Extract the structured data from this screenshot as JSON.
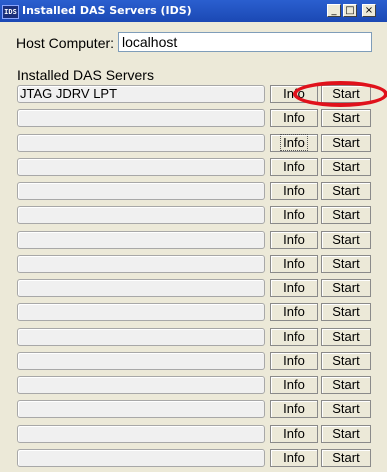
{
  "window": {
    "icon_text": "IDS",
    "title": "Installed DAS Servers (IDS)",
    "controls": {
      "minimize": "_",
      "maximize": "□",
      "close": "×"
    }
  },
  "host": {
    "label": "Host Computer:",
    "value": "localhost"
  },
  "servers": {
    "label": "Installed DAS Servers",
    "rows": [
      {
        "name": "JTAG JDRV LPT",
        "info": "Info",
        "start": "Start"
      },
      {
        "name": "",
        "info": "Info",
        "start": "Start"
      },
      {
        "name": "",
        "info": "Info",
        "start": "Start"
      },
      {
        "name": "",
        "info": "Info",
        "start": "Start"
      },
      {
        "name": "",
        "info": "Info",
        "start": "Start"
      },
      {
        "name": "",
        "info": "Info",
        "start": "Start"
      },
      {
        "name": "",
        "info": "Info",
        "start": "Start"
      },
      {
        "name": "",
        "info": "Info",
        "start": "Start"
      },
      {
        "name": "",
        "info": "Info",
        "start": "Start"
      },
      {
        "name": "",
        "info": "Info",
        "start": "Start"
      },
      {
        "name": "",
        "info": "Info",
        "start": "Start"
      },
      {
        "name": "",
        "info": "Info",
        "start": "Start"
      },
      {
        "name": "",
        "info": "Info",
        "start": "Start"
      },
      {
        "name": "",
        "info": "Info",
        "start": "Start"
      },
      {
        "name": "",
        "info": "Info",
        "start": "Start"
      },
      {
        "name": "",
        "info": "Info",
        "start": "Start"
      }
    ]
  },
  "colors": {
    "titlebar": "#1b48b4",
    "dialog_bg": "#ece9d8",
    "annotation": "#e0111b"
  }
}
